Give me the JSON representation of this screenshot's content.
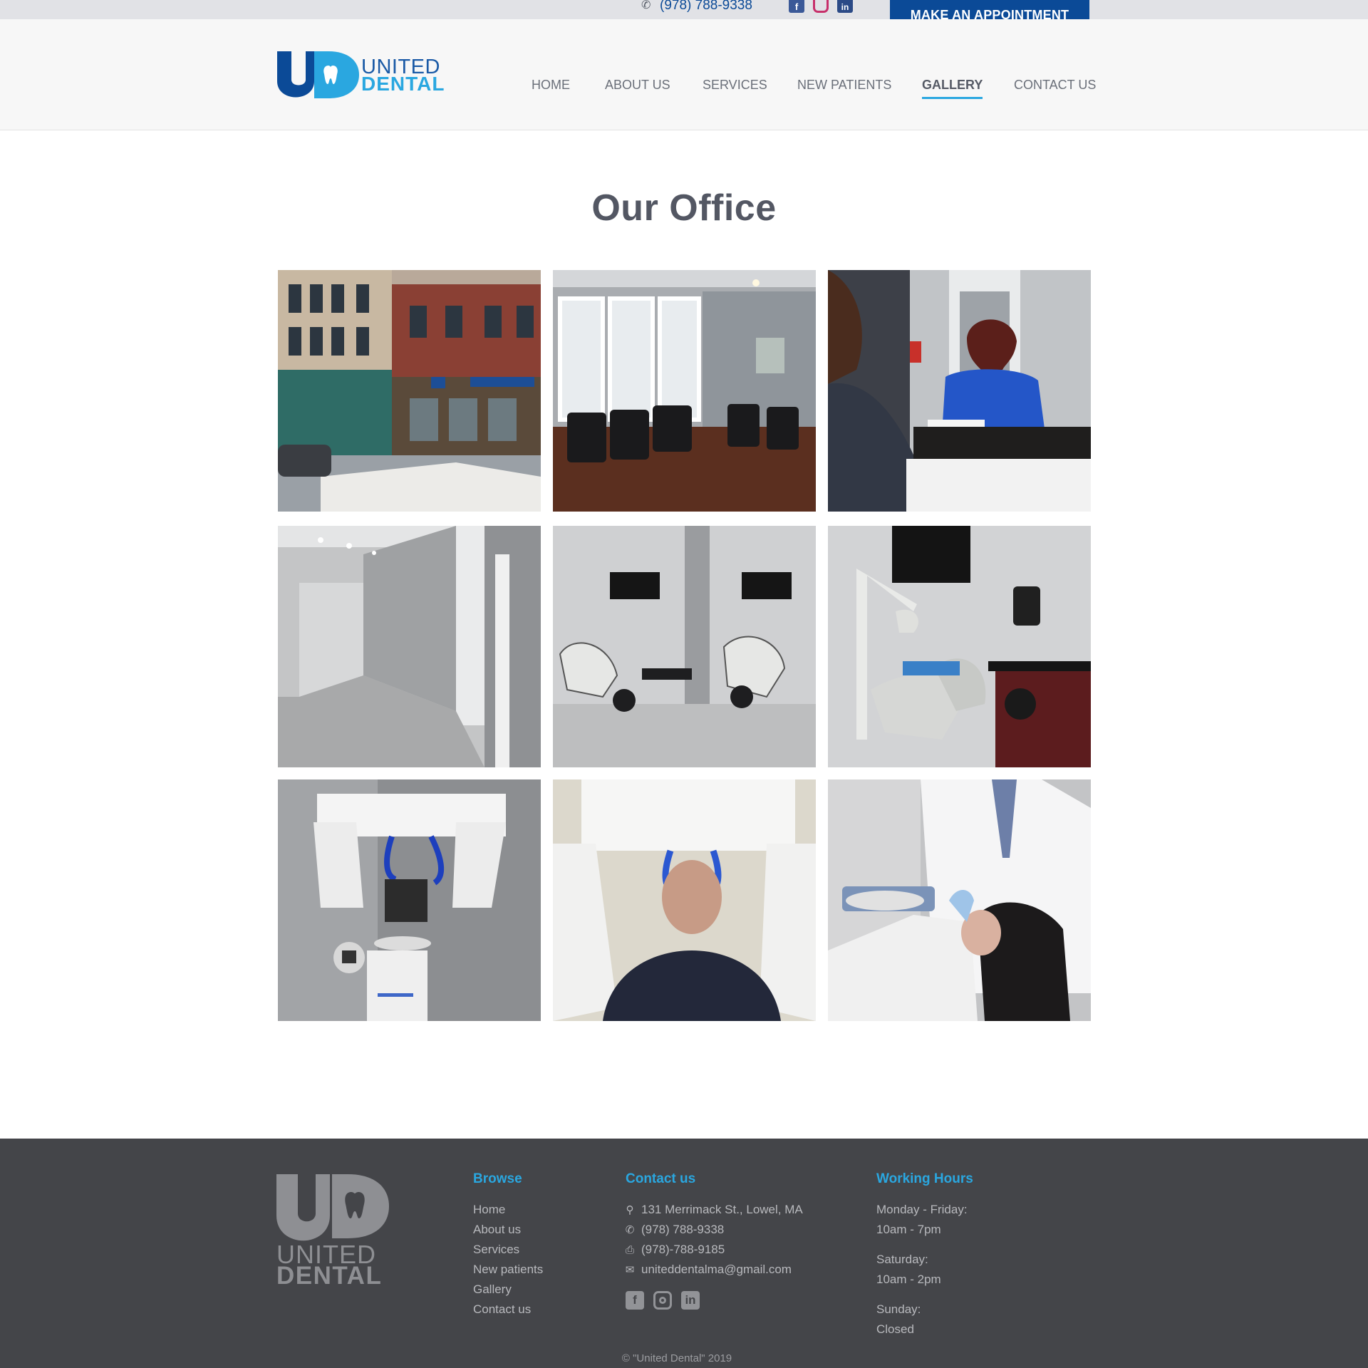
{
  "topbar": {
    "phone": "(978) 788-9338",
    "social": [
      {
        "name": "facebook-icon",
        "glyph": "f"
      },
      {
        "name": "instagram-icon",
        "glyph": ""
      },
      {
        "name": "linkedin-icon",
        "glyph": "in"
      }
    ],
    "appointment_label": "MAKE AN APPOINTMENT"
  },
  "header": {
    "logo_line1": "UNITED",
    "logo_line2": "DENTAL",
    "nav": [
      {
        "label": "HOME",
        "active": false
      },
      {
        "label": "ABOUT US",
        "active": false
      },
      {
        "label": "SERVICES",
        "active": false
      },
      {
        "label": "NEW PATIENTS",
        "active": false
      },
      {
        "label": "GALLERY",
        "active": true
      },
      {
        "label": "CONTACT US",
        "active": false
      }
    ]
  },
  "main": {
    "title": "Our Office",
    "photos": [
      {
        "name": "storefront-photo"
      },
      {
        "name": "waiting-room-photo"
      },
      {
        "name": "reception-desk-photo"
      },
      {
        "name": "hallway-photo"
      },
      {
        "name": "dual-treatment-rooms-photo"
      },
      {
        "name": "treatment-room-photo"
      },
      {
        "name": "xray-machine-photo"
      },
      {
        "name": "xray-patient-photo"
      },
      {
        "name": "dentist-patient-photo"
      }
    ]
  },
  "footer": {
    "logo_line1": "UNITED",
    "logo_line2": "DENTAL",
    "browse_title": "Browse",
    "browse_links": [
      "Home",
      "About us",
      "Services",
      "New patients",
      "Gallery",
      "Contact us"
    ],
    "contact_title": "Contact us",
    "address": "131 Merrimack St., Lowel, MA",
    "phone": "(978) 788-9338",
    "fax": "(978)-788-9185",
    "email": "uniteddentalma@gmail.com",
    "hours_title": "Working Hours",
    "hours": [
      {
        "day": "Monday - Friday:",
        "time": "10am - 7pm"
      },
      {
        "day": "Saturday:",
        "time": "10am - 2pm"
      },
      {
        "day": "Sunday:",
        "time": "Closed"
      }
    ],
    "copyright": "© \"United Dental\" 2019"
  },
  "colors": {
    "brand_blue": "#0b4a97",
    "accent_cyan": "#2aa7e0",
    "footer_bg": "#444549",
    "topbar_bg": "#e1e2e6"
  }
}
